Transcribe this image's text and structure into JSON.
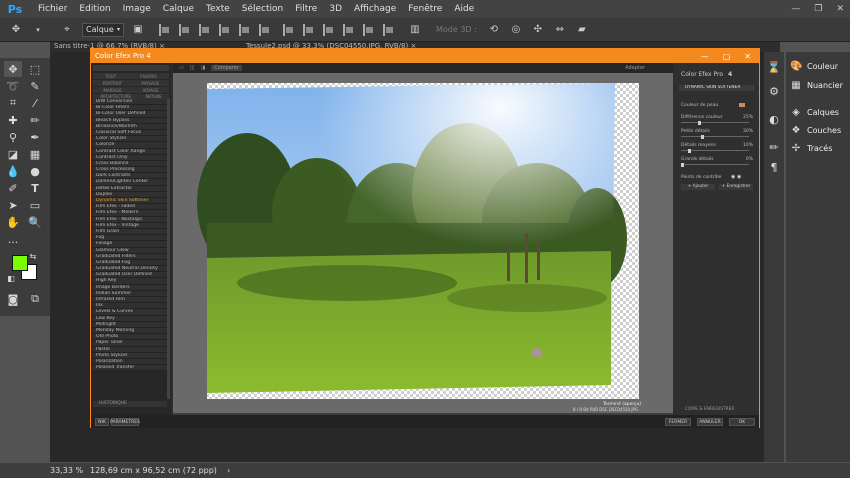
{
  "app": {
    "logo": "Ps",
    "menus": [
      "Fichier",
      "Edition",
      "Image",
      "Calque",
      "Texte",
      "Sélection",
      "Filtre",
      "3D",
      "Affichage",
      "Fenêtre",
      "Aide"
    ]
  },
  "options_bar": {
    "layer_select": "Calque",
    "mode3d": "Mode 3D :"
  },
  "tabs": [
    {
      "label": "Sans titre-1 @ 66,7% (RVB/8) ×"
    },
    {
      "label": "Tessule2.psd @ 33,3% (DSC04550.JPG, RVB/8) ×"
    }
  ],
  "status": {
    "zoom": "33,33 %",
    "doc_size": "128,69 cm x 96,52 cm (72 ppp)"
  },
  "right_panels": {
    "items": [
      {
        "label": "Couleur",
        "icon": "palette-icon"
      },
      {
        "label": "Nuancier",
        "icon": "swatches-icon"
      },
      {
        "label": "Calques",
        "icon": "layers-icon"
      },
      {
        "label": "Couches",
        "icon": "channels-icon"
      },
      {
        "label": "Tracés",
        "icon": "paths-icon"
      }
    ]
  },
  "color_efex": {
    "title": "Color Efex Pro 4",
    "right_title": "Color Efex Pro",
    "right_version": "4",
    "filter_header": "DYNAMIC SKIN SOFTENER",
    "left_tabs": [
      "TOUT",
      "FAVORIS",
      "PORTRAIT",
      "PAYSAGE",
      "MARIAGE",
      "VOYAGE",
      "ARCHITECTURE",
      "NATURE"
    ],
    "filters": [
      "B/W Conversion",
      "Bi-Color Filters",
      "Bi-Color User Defined",
      "Bleach Bypass",
      "Brilliance/Warmth",
      "Classical Soft Focus",
      "Color Stylizer",
      "Colorize",
      "Contrast Color Range",
      "Contrast Only",
      "Cross Balance",
      "Cross Processing",
      "Dark Contrasts",
      "Darken/Lighten Center",
      "Detail Extractor",
      "Duplex",
      "Dynamic Skin Softener",
      "Film Efex - Faded",
      "Film Efex - Modern",
      "Film Efex - Nostalgic",
      "Film Efex - Vintage",
      "Film Grain",
      "Fog",
      "Foliage",
      "Glamour Glow",
      "Graduated Filters",
      "Graduated Fog",
      "Graduated Neutral Density",
      "Graduated User Defined",
      "High Key",
      "Image Borders",
      "Indian Summer",
      "Infrared Film",
      "Ink",
      "Levels & Curves",
      "Low Key",
      "Midnight",
      "Monday Morning",
      "Old Photo",
      "Paper Toner",
      "Pastel",
      "Photo Stylizer",
      "Polarization",
      "Polaroid Transfer"
    ],
    "active_filter": "Dynamic Skin Softener",
    "left_footer": [
      "HISTORIQUE",
      "NIK",
      "PARAMETRES"
    ],
    "canvas_toolbar": [
      "Comparer"
    ],
    "canvas_zoom": "Adapter",
    "right_controls": [
      {
        "label": "Couleur de peau",
        "value": ""
      },
      {
        "label": "Différence couleur",
        "value": "25%"
      },
      {
        "label": "Petits détails",
        "value": "30%"
      },
      {
        "label": "Détails moyens",
        "value": "10%"
      },
      {
        "label": "Grands détails",
        "value": "0%"
      }
    ],
    "opacity_label": "Points de contrôle",
    "add_button": "Ajouter",
    "save_button": "Enregistrer",
    "bottom_right_label": "COPIE & ENREGISTRER",
    "bottom_buttons": [
      "FERMER",
      "ANNULER",
      "OK"
    ],
    "bottom_left_buttons": [
      "NIK",
      "PARAMETRES"
    ],
    "canvas_caption": "Terminé (aperçu)",
    "canvas_caption2": "8 / 8 Bit  RVB  DSC  DSC04550.JPG"
  }
}
